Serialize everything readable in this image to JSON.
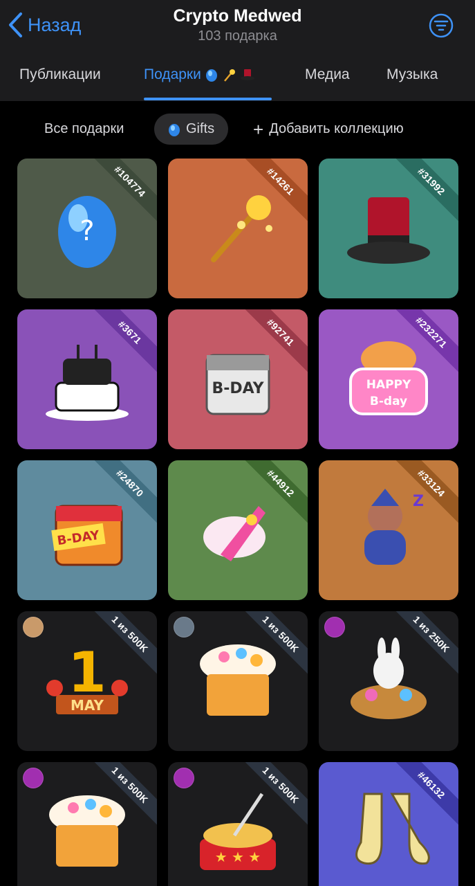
{
  "header": {
    "back_label": "Назад",
    "title": "Crypto Medwed",
    "subtitle": "103 подарка"
  },
  "tabs": [
    {
      "label": "Публикации",
      "active": false
    },
    {
      "label": "Подарки",
      "active": true,
      "icons": [
        "blue-egg-icon",
        "magic-wand-icon",
        "top-hat-icon"
      ]
    },
    {
      "label": "Медиа",
      "active": false
    },
    {
      "label": "Музыка",
      "active": false
    }
  ],
  "chips": [
    {
      "label": "Все подарки",
      "selected": false
    },
    {
      "label": "Gifts",
      "selected": true,
      "icon": "blue-egg-icon"
    },
    {
      "label": "Добавить коллекцию",
      "selected": false,
      "icon": "plus-icon"
    }
  ],
  "colors": {
    "accent": "#3e92f7",
    "header_bg": "#1c1c1e",
    "page_bg": "#000000"
  },
  "gifts": [
    {
      "name": "blue-egg",
      "badge": "#104774",
      "bg": "#4f5a49",
      "ribbon": "#3d4a3a"
    },
    {
      "name": "magic-wand",
      "badge": "#14261",
      "bg": "#c96a3f",
      "ribbon": "#a84e25"
    },
    {
      "name": "top-hat",
      "badge": "#31992",
      "bg": "#3f8c7e",
      "ribbon": "#2a6d61"
    },
    {
      "name": "birthday-cake",
      "badge": "#3671",
      "bg": "#8a52b8",
      "ribbon": "#6b37a0"
    },
    {
      "name": "bday-calendar-silver",
      "badge": "#92741",
      "bg": "#c45a67",
      "ribbon": "#9c3a4a"
    },
    {
      "name": "happy-bday-cat",
      "badge": "#232271",
      "bg": "#9a58c4",
      "ribbon": "#7736ab"
    },
    {
      "name": "bday-calendar-red",
      "badge": "#24870",
      "bg": "#5f8b9e",
      "ribbon": "#416f82"
    },
    {
      "name": "rocket",
      "badge": "#44912",
      "bg": "#5e8a4c",
      "ribbon": "#3f6b30"
    },
    {
      "name": "sleepy-monkey",
      "badge": "#33124",
      "bg": "#c17a3d",
      "ribbon": "#9a5a22"
    },
    {
      "name": "may-1",
      "badge": "1 из 500K",
      "bg": "#1c1c1e",
      "ribbon": "#2c3440",
      "avatar": "#c99a6a"
    },
    {
      "name": "kulich",
      "badge": "1 из 500K",
      "bg": "#1c1c1e",
      "ribbon": "#2c3440",
      "avatar": "#6a7a8a"
    },
    {
      "name": "easter-basket",
      "badge": "1 из 250K",
      "bg": "#1c1c1e",
      "ribbon": "#2c3440",
      "avatar": "#a12fb0"
    },
    {
      "name": "kulich-2",
      "badge": "1 из 500K",
      "bg": "#1c1c1e",
      "ribbon": "#2c3440",
      "avatar": "#a12fb0"
    },
    {
      "name": "noodles",
      "badge": "1 из 500K",
      "bg": "#1c1c1e",
      "ribbon": "#2c3440",
      "avatar": "#a12fb0"
    },
    {
      "name": "socks",
      "badge": "#46132",
      "bg": "#5a5ad0",
      "ribbon": "#3d3aa8"
    }
  ]
}
